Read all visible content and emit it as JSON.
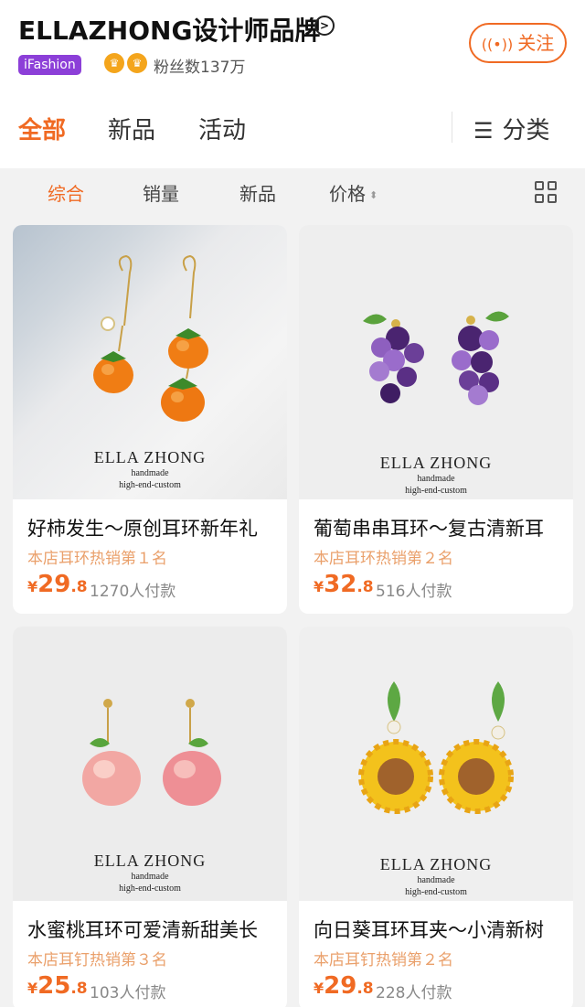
{
  "shop": {
    "name": "ELLAZHONG设计师品牌",
    "badge": "iFashion",
    "fans": "粉丝数137万",
    "follow_label": "关注"
  },
  "tabs": [
    {
      "label": "全部",
      "active": true
    },
    {
      "label": "新品",
      "active": false
    },
    {
      "label": "活动",
      "active": false
    }
  ],
  "category_label": "分类",
  "sort": [
    {
      "label": "综合",
      "active": true
    },
    {
      "label": "销量",
      "active": false
    },
    {
      "label": "新品",
      "active": false
    },
    {
      "label": "价格",
      "active": false
    }
  ],
  "products": [
    {
      "title": "好柿发生～原创耳环新年礼",
      "rank": "本店耳环热销第１名",
      "price_int": "29",
      "price_dec": ".8",
      "currency": "¥",
      "sold": "1270人付款",
      "img_brand": "ELLA ZHONG",
      "img_sub1": "handmade",
      "img_sub2": "high-end-custom"
    },
    {
      "title": "葡萄串串耳环～复古清新耳",
      "rank": "本店耳环热销第２名",
      "price_int": "32",
      "price_dec": ".8",
      "currency": "¥",
      "sold": "516人付款",
      "img_brand": "ELLA ZHONG",
      "img_sub1": "handmade",
      "img_sub2": "high-end-custom"
    },
    {
      "title": "水蜜桃耳环可爱清新甜美长",
      "rank": "本店耳钉热销第３名",
      "price_int": "25",
      "price_dec": ".8",
      "currency": "¥",
      "sold": "103人付款",
      "img_brand": "ELLA ZHONG",
      "img_sub1": "handmade",
      "img_sub2": "high-end-custom"
    },
    {
      "title": "向日葵耳环耳夹～小清新树",
      "rank": "本店耳钉热销第２名",
      "price_int": "29",
      "price_dec": ".8",
      "currency": "¥",
      "sold": "228人付款",
      "img_brand": "ELLA ZHONG",
      "img_sub1": "handmade",
      "img_sub2": "high-end-custom"
    }
  ],
  "colors": {
    "accent": "#f06a23",
    "rank": "#eaa06b",
    "badge": "#8c3fd8"
  }
}
